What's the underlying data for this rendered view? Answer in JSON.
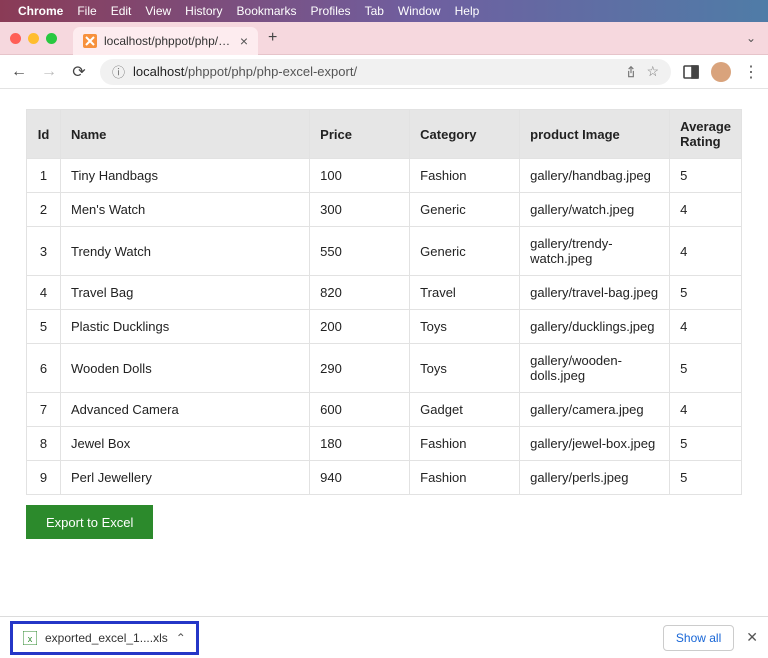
{
  "menubar": {
    "items": [
      "Chrome",
      "File",
      "Edit",
      "View",
      "History",
      "Bookmarks",
      "Profiles",
      "Tab",
      "Window",
      "Help"
    ]
  },
  "tab": {
    "title": "localhost/phppot/php/php-exc"
  },
  "url": {
    "host": "localhost",
    "path": "/phppot/php/php-excel-export/"
  },
  "table": {
    "headers": [
      "Id",
      "Name",
      "Price",
      "Category",
      "product Image",
      "Average Rating"
    ],
    "rows": [
      {
        "id": "1",
        "name": "Tiny Handbags",
        "price": "100",
        "category": "Fashion",
        "image": "gallery/handbag.jpeg",
        "rating": "5"
      },
      {
        "id": "2",
        "name": "Men's Watch",
        "price": "300",
        "category": "Generic",
        "image": "gallery/watch.jpeg",
        "rating": "4"
      },
      {
        "id": "3",
        "name": "Trendy Watch",
        "price": "550",
        "category": "Generic",
        "image": "gallery/trendy-watch.jpeg",
        "rating": "4"
      },
      {
        "id": "4",
        "name": "Travel Bag",
        "price": "820",
        "category": "Travel",
        "image": "gallery/travel-bag.jpeg",
        "rating": "5"
      },
      {
        "id": "5",
        "name": "Plastic Ducklings",
        "price": "200",
        "category": "Toys",
        "image": "gallery/ducklings.jpeg",
        "rating": "4"
      },
      {
        "id": "6",
        "name": "Wooden Dolls",
        "price": "290",
        "category": "Toys",
        "image": "gallery/wooden-dolls.jpeg",
        "rating": "5"
      },
      {
        "id": "7",
        "name": "Advanced Camera",
        "price": "600",
        "category": "Gadget",
        "image": "gallery/camera.jpeg",
        "rating": "4"
      },
      {
        "id": "8",
        "name": "Jewel Box",
        "price": "180",
        "category": "Fashion",
        "image": "gallery/jewel-box.jpeg",
        "rating": "5"
      },
      {
        "id": "9",
        "name": "Perl Jewellery",
        "price": "940",
        "category": "Fashion",
        "image": "gallery/perls.jpeg",
        "rating": "5"
      }
    ]
  },
  "buttons": {
    "export": "Export to Excel",
    "showall": "Show all"
  },
  "download": {
    "filename": "exported_excel_1....xls"
  }
}
